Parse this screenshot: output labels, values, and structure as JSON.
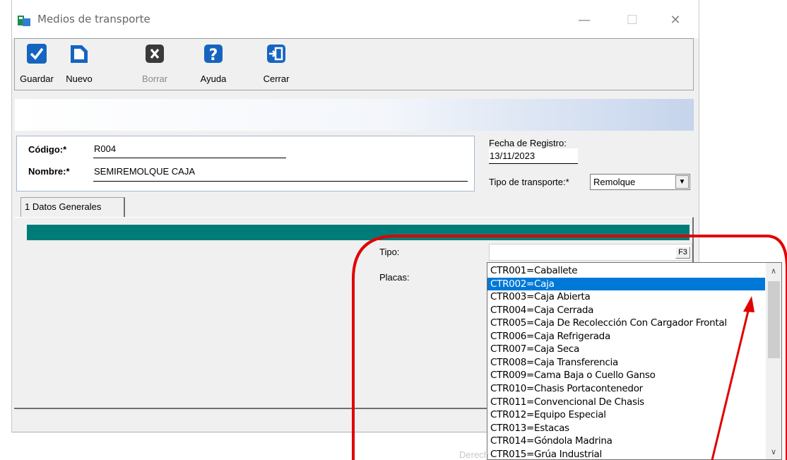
{
  "window": {
    "title": "Medios de transporte",
    "minimize_glyph": "—",
    "maximize_glyph": "☐",
    "close_glyph": "✕"
  },
  "toolbar": {
    "buttons": [
      {
        "label": "Guardar",
        "icon": "check-icon",
        "enabled": true
      },
      {
        "label": "Nuevo",
        "icon": "new-document-icon",
        "enabled": true
      },
      {
        "label": "Borrar",
        "icon": "delete-x-icon",
        "enabled": false
      },
      {
        "label": "Ayuda",
        "icon": "help-question-icon",
        "enabled": true
      },
      {
        "label": "Cerrar",
        "icon": "exit-door-icon",
        "enabled": true
      }
    ]
  },
  "form": {
    "codigo_label": "Código:*",
    "codigo_value": "R004",
    "nombre_label": "Nombre:*",
    "nombre_value": "SEMIREMOLQUE CAJA",
    "fecha_label": "Fecha de Registro:",
    "fecha_value": "13/11/2023",
    "tipo_transporte_label": "Tipo de transporte:*",
    "tipo_transporte_value": "Remolque"
  },
  "tabs": [
    {
      "label": "1 Datos Generales"
    }
  ],
  "general": {
    "tipo_label": "Tipo:",
    "tipo_value": "",
    "f3_label": "F3",
    "placas_label": "Placas:"
  },
  "dropdown": {
    "selected_index": 1,
    "options": [
      "CTR001=Caballete",
      "CTR002=Caja",
      "CTR003=Caja Abierta",
      "CTR004=Caja Cerrada",
      "CTR005=Caja De Recolección Con Cargador Frontal",
      "CTR006=Caja Refrigerada",
      "CTR007=Caja Seca",
      "CTR008=Caja Transferencia",
      "CTR009=Cama Baja o Cuello Ganso",
      "CTR010=Chasis Portacontenedor",
      "CTR011=Convencional De Chasis",
      "CTR012=Equipo Especial",
      "CTR013=Estacas",
      "CTR014=Góndola Madrina",
      "CTR015=Grúa Industrial"
    ]
  },
  "background_text": "Derech",
  "colors": {
    "teal_bar": "#007c78",
    "selection": "#0078d7",
    "annotation": "#e00000",
    "toolbar_icon": "#1565c0"
  }
}
